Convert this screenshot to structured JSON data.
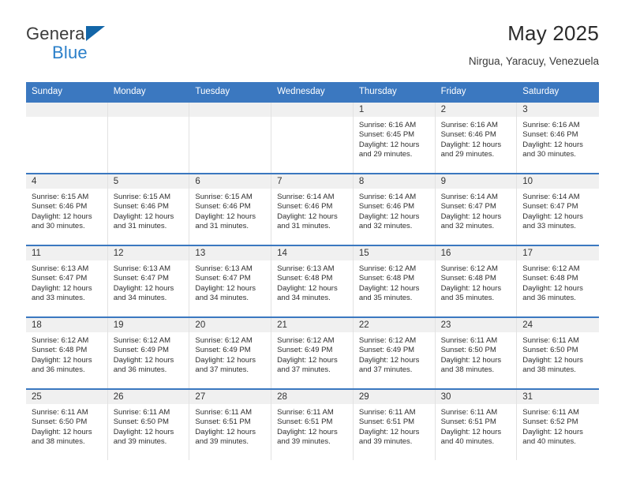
{
  "brand": {
    "name_top": "General",
    "name_bottom": "Blue",
    "triangle_icon": "triangle-icon",
    "color_top": "#3c3c3c",
    "color_bottom": "#2a7fc9"
  },
  "header": {
    "title": "May 2025",
    "subtitle": "Nirgua, Yaracuy, Venezuela"
  },
  "theme": {
    "header_blue": "#3b78c0",
    "day_band_gray": "#f0f0f0",
    "text_dark": "#2e2e2e"
  },
  "weekdays": [
    "Sunday",
    "Monday",
    "Tuesday",
    "Wednesday",
    "Thursday",
    "Friday",
    "Saturday"
  ],
  "weeks": [
    [
      {
        "empty": true
      },
      {
        "empty": true
      },
      {
        "empty": true
      },
      {
        "empty": true
      },
      {
        "day": "1",
        "sunrise": "Sunrise: 6:16 AM",
        "sunset": "Sunset: 6:45 PM",
        "daylight1": "Daylight: 12 hours",
        "daylight2": "and 29 minutes."
      },
      {
        "day": "2",
        "sunrise": "Sunrise: 6:16 AM",
        "sunset": "Sunset: 6:46 PM",
        "daylight1": "Daylight: 12 hours",
        "daylight2": "and 29 minutes."
      },
      {
        "day": "3",
        "sunrise": "Sunrise: 6:16 AM",
        "sunset": "Sunset: 6:46 PM",
        "daylight1": "Daylight: 12 hours",
        "daylight2": "and 30 minutes."
      }
    ],
    [
      {
        "day": "4",
        "sunrise": "Sunrise: 6:15 AM",
        "sunset": "Sunset: 6:46 PM",
        "daylight1": "Daylight: 12 hours",
        "daylight2": "and 30 minutes."
      },
      {
        "day": "5",
        "sunrise": "Sunrise: 6:15 AM",
        "sunset": "Sunset: 6:46 PM",
        "daylight1": "Daylight: 12 hours",
        "daylight2": "and 31 minutes."
      },
      {
        "day": "6",
        "sunrise": "Sunrise: 6:15 AM",
        "sunset": "Sunset: 6:46 PM",
        "daylight1": "Daylight: 12 hours",
        "daylight2": "and 31 minutes."
      },
      {
        "day": "7",
        "sunrise": "Sunrise: 6:14 AM",
        "sunset": "Sunset: 6:46 PM",
        "daylight1": "Daylight: 12 hours",
        "daylight2": "and 31 minutes."
      },
      {
        "day": "8",
        "sunrise": "Sunrise: 6:14 AM",
        "sunset": "Sunset: 6:46 PM",
        "daylight1": "Daylight: 12 hours",
        "daylight2": "and 32 minutes."
      },
      {
        "day": "9",
        "sunrise": "Sunrise: 6:14 AM",
        "sunset": "Sunset: 6:47 PM",
        "daylight1": "Daylight: 12 hours",
        "daylight2": "and 32 minutes."
      },
      {
        "day": "10",
        "sunrise": "Sunrise: 6:14 AM",
        "sunset": "Sunset: 6:47 PM",
        "daylight1": "Daylight: 12 hours",
        "daylight2": "and 33 minutes."
      }
    ],
    [
      {
        "day": "11",
        "sunrise": "Sunrise: 6:13 AM",
        "sunset": "Sunset: 6:47 PM",
        "daylight1": "Daylight: 12 hours",
        "daylight2": "and 33 minutes."
      },
      {
        "day": "12",
        "sunrise": "Sunrise: 6:13 AM",
        "sunset": "Sunset: 6:47 PM",
        "daylight1": "Daylight: 12 hours",
        "daylight2": "and 34 minutes."
      },
      {
        "day": "13",
        "sunrise": "Sunrise: 6:13 AM",
        "sunset": "Sunset: 6:47 PM",
        "daylight1": "Daylight: 12 hours",
        "daylight2": "and 34 minutes."
      },
      {
        "day": "14",
        "sunrise": "Sunrise: 6:13 AM",
        "sunset": "Sunset: 6:48 PM",
        "daylight1": "Daylight: 12 hours",
        "daylight2": "and 34 minutes."
      },
      {
        "day": "15",
        "sunrise": "Sunrise: 6:12 AM",
        "sunset": "Sunset: 6:48 PM",
        "daylight1": "Daylight: 12 hours",
        "daylight2": "and 35 minutes."
      },
      {
        "day": "16",
        "sunrise": "Sunrise: 6:12 AM",
        "sunset": "Sunset: 6:48 PM",
        "daylight1": "Daylight: 12 hours",
        "daylight2": "and 35 minutes."
      },
      {
        "day": "17",
        "sunrise": "Sunrise: 6:12 AM",
        "sunset": "Sunset: 6:48 PM",
        "daylight1": "Daylight: 12 hours",
        "daylight2": "and 36 minutes."
      }
    ],
    [
      {
        "day": "18",
        "sunrise": "Sunrise: 6:12 AM",
        "sunset": "Sunset: 6:48 PM",
        "daylight1": "Daylight: 12 hours",
        "daylight2": "and 36 minutes."
      },
      {
        "day": "19",
        "sunrise": "Sunrise: 6:12 AM",
        "sunset": "Sunset: 6:49 PM",
        "daylight1": "Daylight: 12 hours",
        "daylight2": "and 36 minutes."
      },
      {
        "day": "20",
        "sunrise": "Sunrise: 6:12 AM",
        "sunset": "Sunset: 6:49 PM",
        "daylight1": "Daylight: 12 hours",
        "daylight2": "and 37 minutes."
      },
      {
        "day": "21",
        "sunrise": "Sunrise: 6:12 AM",
        "sunset": "Sunset: 6:49 PM",
        "daylight1": "Daylight: 12 hours",
        "daylight2": "and 37 minutes."
      },
      {
        "day": "22",
        "sunrise": "Sunrise: 6:12 AM",
        "sunset": "Sunset: 6:49 PM",
        "daylight1": "Daylight: 12 hours",
        "daylight2": "and 37 minutes."
      },
      {
        "day": "23",
        "sunrise": "Sunrise: 6:11 AM",
        "sunset": "Sunset: 6:50 PM",
        "daylight1": "Daylight: 12 hours",
        "daylight2": "and 38 minutes."
      },
      {
        "day": "24",
        "sunrise": "Sunrise: 6:11 AM",
        "sunset": "Sunset: 6:50 PM",
        "daylight1": "Daylight: 12 hours",
        "daylight2": "and 38 minutes."
      }
    ],
    [
      {
        "day": "25",
        "sunrise": "Sunrise: 6:11 AM",
        "sunset": "Sunset: 6:50 PM",
        "daylight1": "Daylight: 12 hours",
        "daylight2": "and 38 minutes."
      },
      {
        "day": "26",
        "sunrise": "Sunrise: 6:11 AM",
        "sunset": "Sunset: 6:50 PM",
        "daylight1": "Daylight: 12 hours",
        "daylight2": "and 39 minutes."
      },
      {
        "day": "27",
        "sunrise": "Sunrise: 6:11 AM",
        "sunset": "Sunset: 6:51 PM",
        "daylight1": "Daylight: 12 hours",
        "daylight2": "and 39 minutes."
      },
      {
        "day": "28",
        "sunrise": "Sunrise: 6:11 AM",
        "sunset": "Sunset: 6:51 PM",
        "daylight1": "Daylight: 12 hours",
        "daylight2": "and 39 minutes."
      },
      {
        "day": "29",
        "sunrise": "Sunrise: 6:11 AM",
        "sunset": "Sunset: 6:51 PM",
        "daylight1": "Daylight: 12 hours",
        "daylight2": "and 39 minutes."
      },
      {
        "day": "30",
        "sunrise": "Sunrise: 6:11 AM",
        "sunset": "Sunset: 6:51 PM",
        "daylight1": "Daylight: 12 hours",
        "daylight2": "and 40 minutes."
      },
      {
        "day": "31",
        "sunrise": "Sunrise: 6:11 AM",
        "sunset": "Sunset: 6:52 PM",
        "daylight1": "Daylight: 12 hours",
        "daylight2": "and 40 minutes."
      }
    ]
  ]
}
